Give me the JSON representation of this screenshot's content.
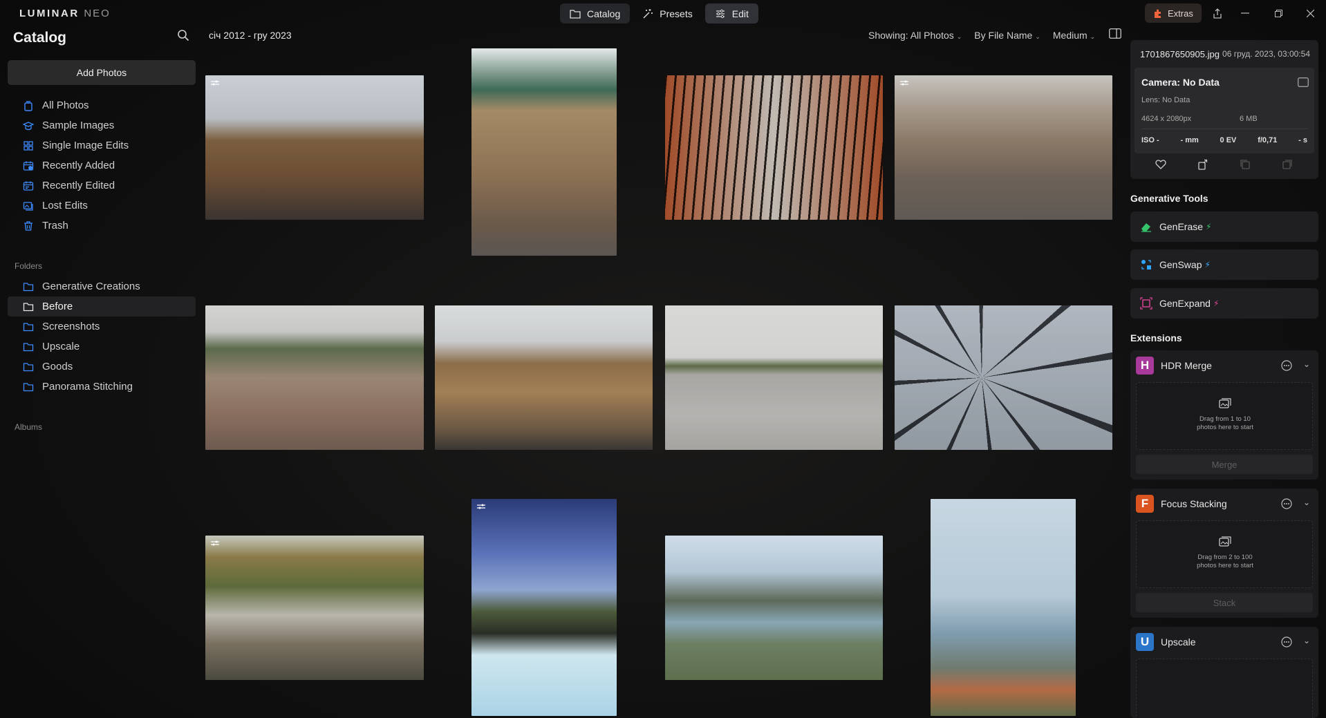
{
  "app": {
    "brand": "LUMINAR",
    "brand_suffix": "NEO"
  },
  "modes": {
    "catalog": "Catalog",
    "presets": "Presets",
    "edit": "Edit"
  },
  "extras_label": "Extras",
  "sidebar": {
    "title": "Catalog",
    "add_photos": "Add Photos",
    "nav": [
      {
        "label": "All Photos",
        "icon": "photo-stack-icon"
      },
      {
        "label": "Sample Images",
        "icon": "graduation-cap-icon"
      },
      {
        "label": "Single Image Edits",
        "icon": "grid-icon"
      },
      {
        "label": "Recently Added",
        "icon": "calendar-add-icon"
      },
      {
        "label": "Recently Edited",
        "icon": "calendar-edit-icon"
      },
      {
        "label": "Lost Edits",
        "icon": "images-icon"
      },
      {
        "label": "Trash",
        "icon": "trash-icon"
      }
    ],
    "folders_label": "Folders",
    "folders": [
      {
        "label": "Generative Creations"
      },
      {
        "label": "Before"
      },
      {
        "label": "Screenshots"
      },
      {
        "label": "Upscale"
      },
      {
        "label": "Goods"
      },
      {
        "label": "Panorama Stitching"
      }
    ],
    "albums_label": "Albums"
  },
  "toolbar": {
    "date_range": "січ 2012 - гру 2023",
    "showing": "Showing: All Photos",
    "sort": "By File Name",
    "size": "Medium"
  },
  "info": {
    "filename": "1701867650905.jpg",
    "date": "06 груд. 2023, 03:00:54",
    "camera": "Camera: No Data",
    "lens": "Lens: No Data",
    "dimensions": "4624 x 2080px",
    "filesize": "6 MB",
    "iso": "ISO -",
    "focal": "- mm",
    "ev": "0 EV",
    "aperture": "f/0,71",
    "shutter": "- s"
  },
  "generative": {
    "heading": "Generative Tools",
    "tools": [
      {
        "label": "GenErase",
        "color": "#34c26b"
      },
      {
        "label": "GenSwap",
        "color": "#2fa6ff"
      },
      {
        "label": "GenExpand",
        "color": "#e0449a"
      }
    ]
  },
  "extensions": {
    "heading": "Extensions",
    "items": [
      {
        "letter": "H",
        "name": "HDR Merge",
        "color": "#a73a9a",
        "drop_line1": "Drag from 1 to 10",
        "drop_line2": "photos here to start",
        "action": "Merge"
      },
      {
        "letter": "F",
        "name": "Focus Stacking",
        "color": "#d9541f",
        "drop_line1": "Drag from 2 to 100",
        "drop_line2": "photos here to start",
        "action": "Stack"
      },
      {
        "letter": "U",
        "name": "Upscale",
        "color": "#2b76c8"
      }
    ]
  },
  "colors": {
    "accent_blue": "#3d8bfd",
    "background": "#0b0b0c",
    "panel": "#1f1f21"
  }
}
